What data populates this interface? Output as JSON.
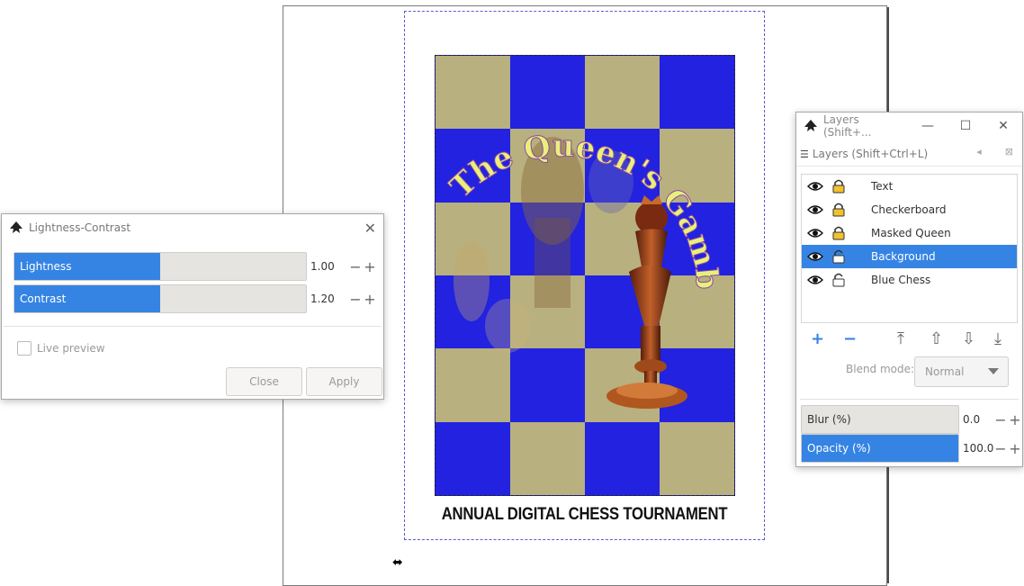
{
  "canvas": {
    "tournament_text": "ANNUAL DIGITAL CHESS TOURNAMENT",
    "poster_title": "The Queen's Gambit",
    "colors": {
      "dark_square": "#2222e0",
      "light_square": "#b8b07e",
      "title": "#e9f07a",
      "title_outline": "#8a4aa8"
    }
  },
  "lightness_contrast": {
    "title": "Lightness-Contrast",
    "lightness": {
      "label": "Lightness",
      "value": "1.00",
      "fill": 0.5
    },
    "contrast": {
      "label": "Contrast",
      "value": "1.20",
      "fill": 0.5
    },
    "live_preview_label": "Live preview",
    "live_preview_checked": false,
    "close_label": "Close",
    "apply_label": "Apply"
  },
  "layers_dialog": {
    "title": "Layers (Shift+...",
    "tab_label": "Layers (Shift+Ctrl+L)",
    "layers": [
      {
        "name": "Text",
        "visible": true,
        "locked": true,
        "selected": false
      },
      {
        "name": "Checkerboard",
        "visible": true,
        "locked": true,
        "selected": false
      },
      {
        "name": "Masked Queen",
        "visible": true,
        "locked": true,
        "selected": false
      },
      {
        "name": "Background",
        "visible": true,
        "locked": false,
        "selected": true
      },
      {
        "name": "Blue Chess",
        "visible": true,
        "locked": false,
        "selected": false
      }
    ],
    "blend_mode_label": "Blend mode:",
    "blend_mode_value": "Normal",
    "blur": {
      "label": "Blur (%)",
      "value": "0.0",
      "fill": 0
    },
    "opacity": {
      "label": "Opacity (%)",
      "value": "100.0",
      "fill": 1
    },
    "accent": "#3584e4"
  }
}
